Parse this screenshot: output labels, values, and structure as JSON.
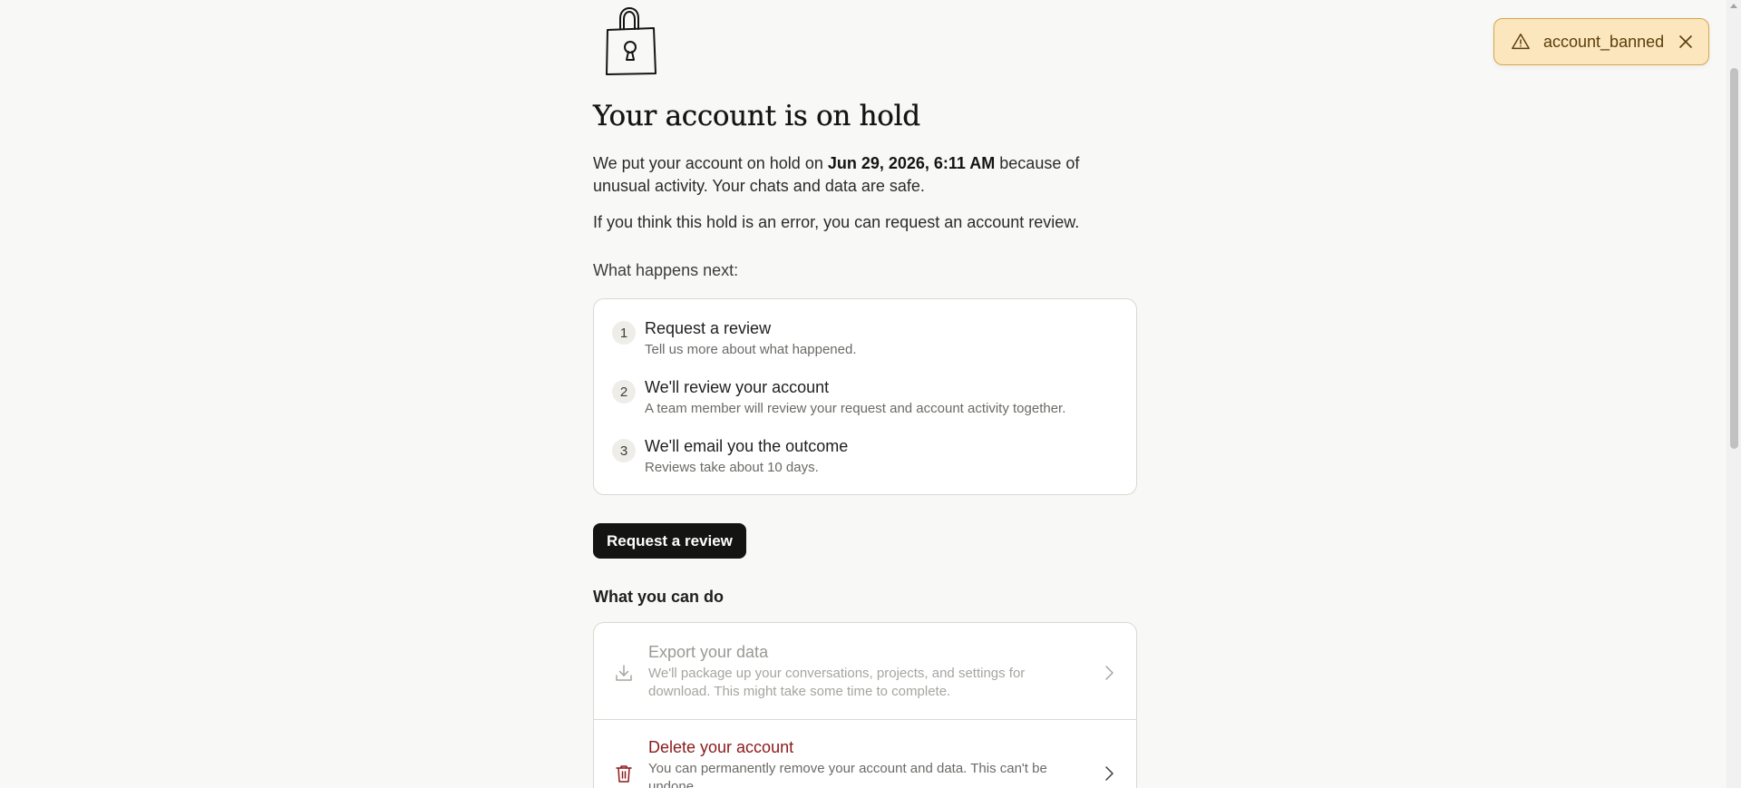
{
  "toast": {
    "icon": "warning-icon",
    "message": "account_banned",
    "close_icon": "close-icon",
    "accent": "#fbe6bd"
  },
  "hero": {
    "icon": "lock-icon",
    "title": "Your account is on hold",
    "para1_before": "We put your account on hold on ",
    "para1_date": "Jun 29, 2026, 6:11 AM",
    "para1_after": " because of unusual activity. Your chats and data are safe.",
    "para2": "If you think this hold is an error, you can request an account review."
  },
  "next": {
    "label": "What happens next:",
    "steps": [
      {
        "number": "1",
        "title": "Request a review",
        "description": "Tell us more about what happened."
      },
      {
        "number": "2",
        "title": "We'll review your account",
        "description": "A team member will review your request and account activity together."
      },
      {
        "number": "3",
        "title": "We'll email you the outcome",
        "description": "Reviews take about 10 days."
      }
    ]
  },
  "review_button": {
    "label": "Request a review"
  },
  "can_do": {
    "label": "What you can do",
    "actions": [
      {
        "icon": "download-icon",
        "title": "Export your data",
        "description": "We'll package up your conversations, projects, and settings for download. This might take some time to complete.",
        "state": "disabled"
      },
      {
        "icon": "trash-icon",
        "title": "Delete your account",
        "description": "You can permanently remove your account and data. This can't be undone.",
        "color": "#8b1a1a"
      }
    ]
  }
}
